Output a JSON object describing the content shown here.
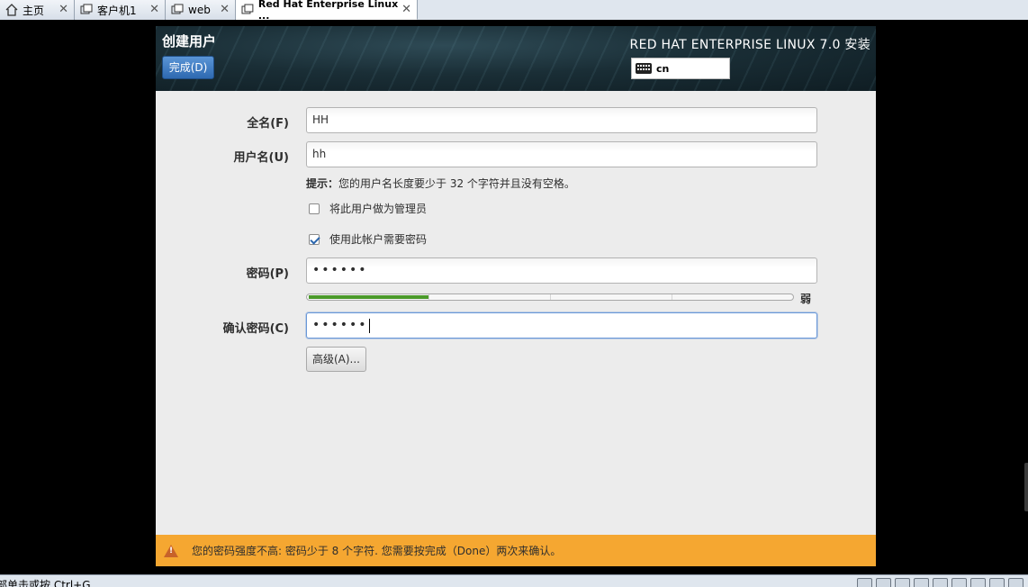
{
  "vm_tabs": [
    {
      "label": "主页",
      "icon": "home-icon",
      "active": false
    },
    {
      "label": "客户机1",
      "icon": "vm-icon",
      "active": false
    },
    {
      "label": "web",
      "icon": "vm-icon",
      "active": false
    },
    {
      "label": "Red Hat Enterprise Linux ...",
      "icon": "vm-icon",
      "active": true
    }
  ],
  "vm_tab_close_glyph": "✕",
  "header": {
    "spoke_title": "创建用户",
    "done_button": "完成(D)",
    "product_title": "RED HAT ENTERPRISE LINUX 7.0 安装",
    "keyboard_layout": "cn"
  },
  "form": {
    "fullname_label": "全名(F)",
    "fullname_value": "HH",
    "username_label": "用户名(U)",
    "username_value": "hh",
    "hint_prefix": "提示：",
    "hint_text": "您的用户名长度要少于 32 个字符并且没有空格。",
    "admin_checkbox_label": "将此用户做为管理员",
    "admin_checked": false,
    "require_password_label": "使用此帐户需要密码",
    "require_password_checked": true,
    "password_label": "密码(P)",
    "password_mask": "••••••",
    "strength_fraction": 0.25,
    "strength_label": "弱",
    "confirm_label": "确认密码(C)",
    "confirm_mask": "••••••",
    "advanced_button": "高级(A)..."
  },
  "warning": {
    "icon": "warning-icon",
    "text": "您的密码强度不高: 密码少于 8 个字符. 您需要按完成（Done）两次来确认。",
    "color": "#f5a731"
  },
  "statusbar": {
    "text": "部单击或按 Ctrl+G"
  },
  "colors": {
    "header_bg": "#1a2e36",
    "done_button": "#2e69b1",
    "strength_fill": "#4a9a2a"
  }
}
